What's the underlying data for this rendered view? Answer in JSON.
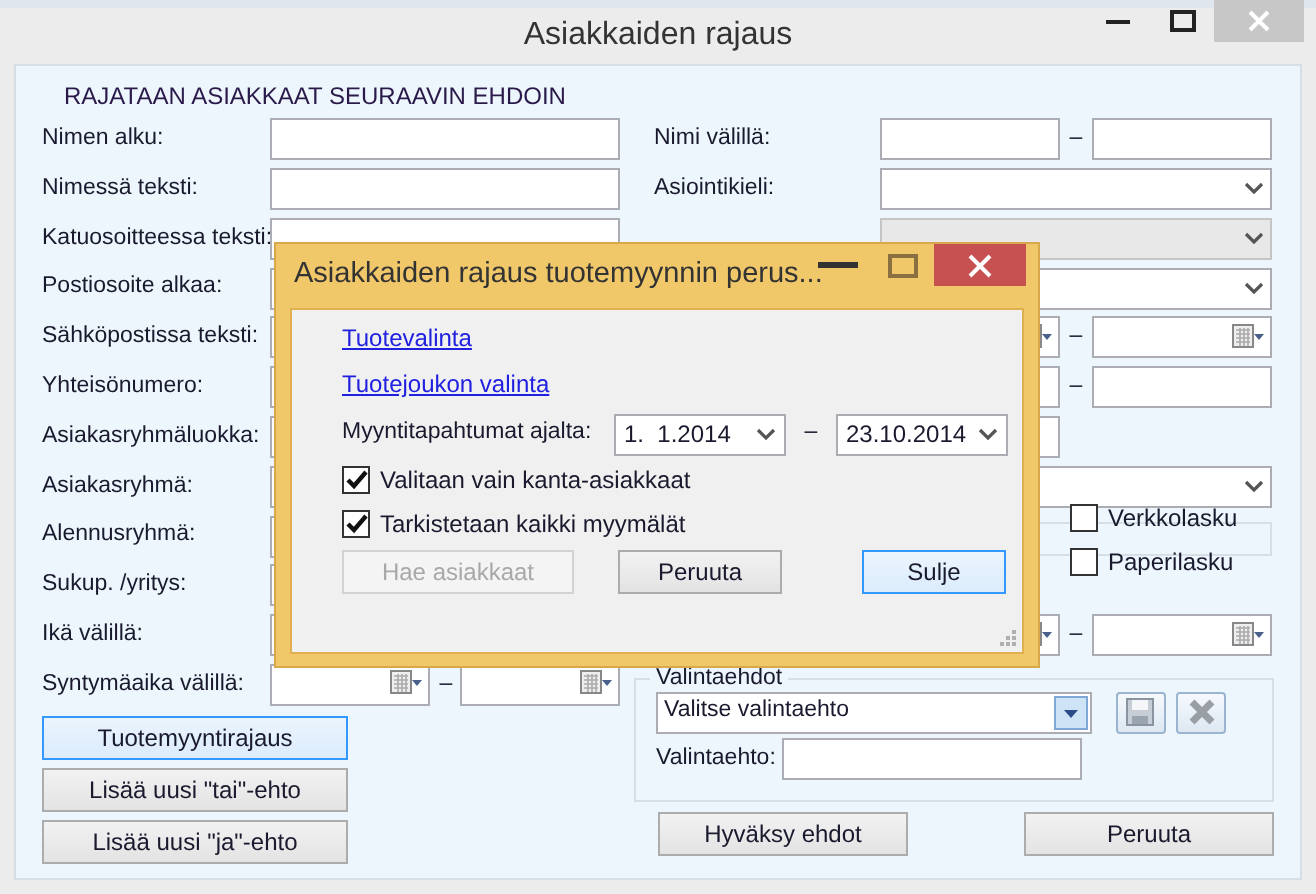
{
  "window": {
    "title": "Asiakkaiden rajaus"
  },
  "heading": "RAJATAAN ASIAKKAAT SEURAAVIN EHDOIN",
  "left_rows": [
    {
      "label": "Nimen alku:"
    },
    {
      "label": "Nimessä teksti:"
    },
    {
      "label": "Katuosoitteessa teksti:"
    },
    {
      "label": "Postiosoite alkaa:"
    },
    {
      "label": "Sähköpostissa teksti:"
    },
    {
      "label": "Yhteisönumero:"
    },
    {
      "label": "Asiakasryhmäluokka:"
    },
    {
      "label": "Asiakasryhmä:"
    },
    {
      "label": "Alennusryhmä:"
    },
    {
      "label": "Sukup. /yritys:"
    },
    {
      "label": "Ikä välillä:"
    }
  ],
  "right_rows": [
    {
      "label": "Nimi välillä:",
      "kind": "text-pair",
      "separator": "–"
    },
    {
      "label": "Asiointikieli:",
      "kind": "dropdown",
      "disabled": false
    },
    {
      "kind": "dropdown",
      "disabled": true
    },
    {
      "kind": "dropdown",
      "disabled": false
    },
    {
      "kind": "date-pair",
      "separator": "–"
    },
    {
      "kind": "text-pair",
      "separator": "–"
    },
    {
      "kind": "text"
    },
    {
      "kind": "dropdown",
      "disabled": false
    },
    {
      "kind": "checkbox-group",
      "checkboxes": [
        {
          "label": "Verkkolasku",
          "checked": false
        },
        {
          "label": "Paperilasku",
          "checked": false
        }
      ]
    },
    {
      "kind": "date-pair",
      "separator": "–"
    }
  ],
  "birth_row": {
    "label": "Syntymäaika välillä:",
    "separator": "–"
  },
  "left_buttons": [
    {
      "label": "Tuotemyyntirajaus",
      "focused": true
    },
    {
      "label": "Lisää uusi \"tai\"-ehto",
      "focused": false
    },
    {
      "label": "Lisää uusi \"ja\"-ehto",
      "focused": false
    }
  ],
  "criteria": {
    "title": "Valintaehdot",
    "dropdown_value": "Valitse valintaehto",
    "field_label": "Valintaehto:"
  },
  "bottom_buttons": [
    {
      "label": "Hyväksy ehdot"
    },
    {
      "label": "Peruuta"
    }
  ],
  "dialog": {
    "title": "Asiakkaiden rajaus tuotemyynnin perus...",
    "links": [
      "Tuotevalinta",
      "Tuotejoukon valinta"
    ],
    "date_label": "Myyntitapahtumat ajalta:",
    "date_from": "1.  1.2014",
    "separator": "–",
    "date_to": "23.10.2014",
    "checkboxes": [
      {
        "label": "Valitaan vain kanta-asiakkaat",
        "checked": true
      },
      {
        "label": "Tarkistetaan kaikki myymälät",
        "checked": true
      }
    ],
    "buttons": [
      {
        "label": "Hae asiakkaat",
        "disabled": true,
        "focused": false
      },
      {
        "label": "Peruuta",
        "disabled": false,
        "focused": false
      },
      {
        "label": "Sulje",
        "disabled": false,
        "focused": true
      }
    ]
  }
}
